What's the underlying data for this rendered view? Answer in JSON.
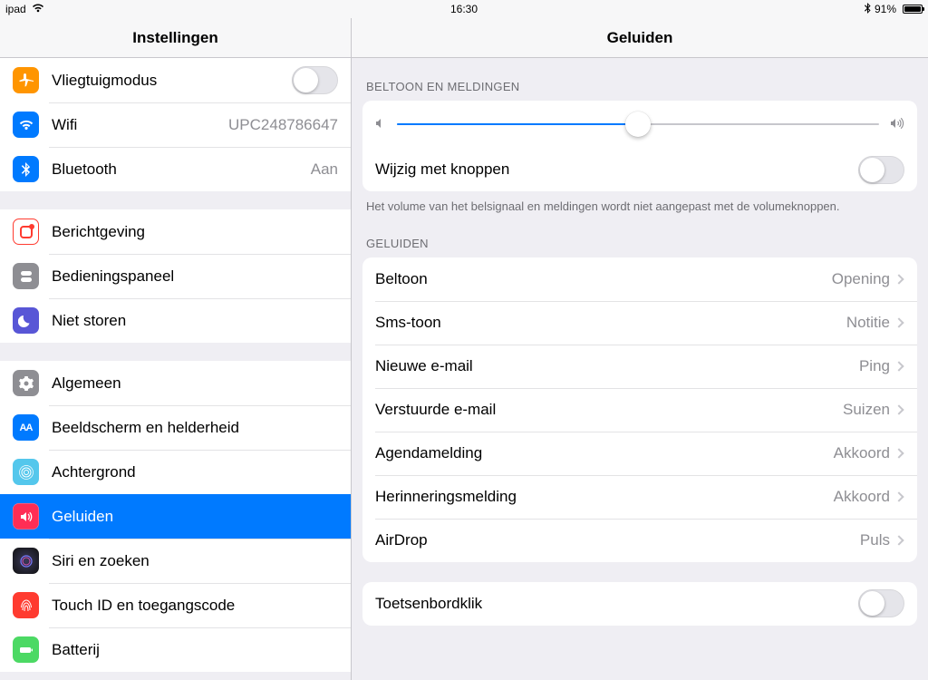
{
  "statusbar": {
    "device": "ipad",
    "time": "16:30",
    "battery_pct": "91%",
    "battery_fill_pct": 91,
    "bluetooth": true
  },
  "sidebar": {
    "title": "Instellingen",
    "items": [
      {
        "label": "Vliegtuigmodus",
        "toggle": false
      },
      {
        "label": "Wifi",
        "value": "UPC248786647"
      },
      {
        "label": "Bluetooth",
        "value": "Aan"
      },
      {
        "label": "Berichtgeving"
      },
      {
        "label": "Bedieningspaneel"
      },
      {
        "label": "Niet storen"
      },
      {
        "label": "Algemeen"
      },
      {
        "label": "Beeldscherm en helderheid"
      },
      {
        "label": "Achtergrond"
      },
      {
        "label": "Geluiden",
        "selected": true
      },
      {
        "label": "Siri en zoeken"
      },
      {
        "label": "Touch ID en toegangscode"
      },
      {
        "label": "Batterij"
      }
    ]
  },
  "detail": {
    "title": "Geluiden",
    "section_ringtone": "BELTOON EN MELDINGEN",
    "slider_value_pct": 50,
    "change_with_buttons": {
      "label": "Wijzig met knoppen",
      "on": false
    },
    "buttons_footer": "Het volume van het belsignaal en meldingen wordt niet aangepast met de volumeknoppen.",
    "section_sounds": "GELUIDEN",
    "sound_items": [
      {
        "label": "Beltoon",
        "value": "Opening"
      },
      {
        "label": "Sms-toon",
        "value": "Notitie"
      },
      {
        "label": "Nieuwe e-mail",
        "value": "Ping"
      },
      {
        "label": "Verstuurde e-mail",
        "value": "Suizen"
      },
      {
        "label": "Agendamelding",
        "value": "Akkoord"
      },
      {
        "label": "Herinneringsmelding",
        "value": "Akkoord"
      },
      {
        "label": "AirDrop",
        "value": "Puls"
      }
    ],
    "keyboard_click": {
      "label": "Toetsenbordklik",
      "on": false
    }
  }
}
